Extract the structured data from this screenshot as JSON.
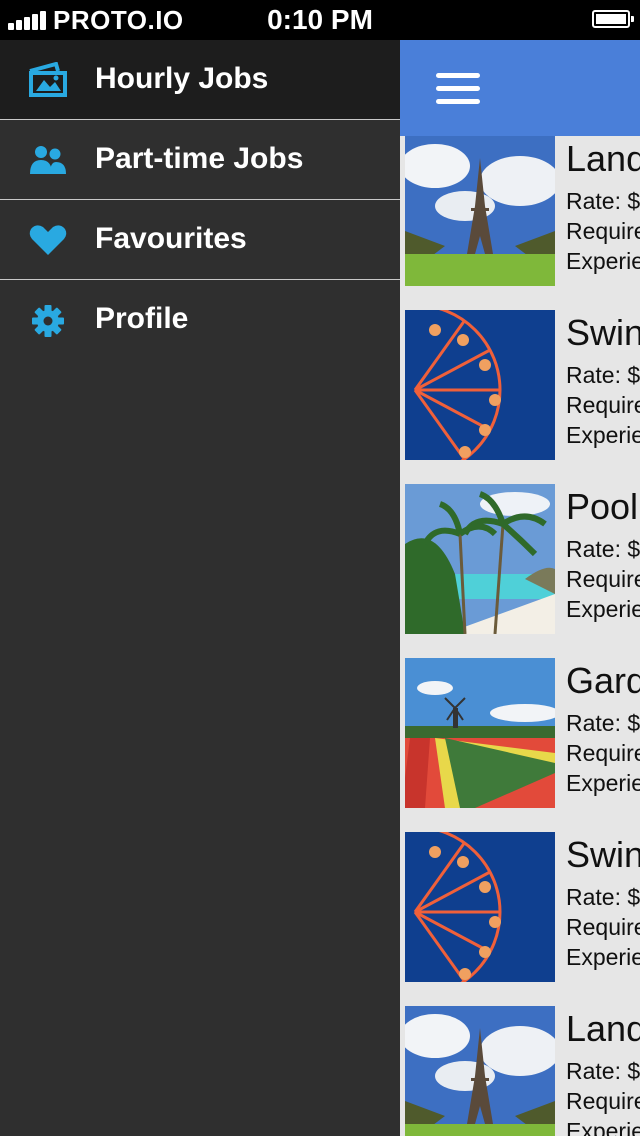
{
  "status": {
    "carrier": "PROTO.IO",
    "time": "0:10 PM"
  },
  "menu": {
    "items": [
      {
        "label": "Hourly Jobs",
        "icon": "photo-icon",
        "active": true
      },
      {
        "label": "Part-time Jobs",
        "icon": "users-icon",
        "active": false
      },
      {
        "label": "Favourites",
        "icon": "heart-icon",
        "active": false
      },
      {
        "label": "Profile",
        "icon": "gear-icon",
        "active": false
      }
    ]
  },
  "colors": {
    "accent": "#4a7fd9",
    "icon": "#29a9e1",
    "menu_bg": "#2f2f2f",
    "menu_active_bg": "#1d1d1d",
    "list_bg": "#e6e6e6"
  },
  "header": {
    "menu_icon": "hamburger-icon"
  },
  "jobs": [
    {
      "title": "Land",
      "rate": "Rate: $",
      "requirements": "Require",
      "experience": "Experie",
      "image": "eiffel-tower"
    },
    {
      "title": "Swin",
      "rate": "Rate: $",
      "requirements": "Require",
      "experience": "Experie",
      "image": "ferris-wheel"
    },
    {
      "title": "Pool",
      "rate": "Rate: $",
      "requirements": "Require",
      "experience": "Experie",
      "image": "palm-beach"
    },
    {
      "title": "Gard",
      "rate": "Rate: $",
      "requirements": "Require",
      "experience": "Experie",
      "image": "tulip-field"
    },
    {
      "title": "Swin",
      "rate": "Rate: $",
      "requirements": "Require",
      "experience": "Experie",
      "image": "ferris-wheel"
    },
    {
      "title": "Land",
      "rate": "Rate: $",
      "requirements": "Require",
      "experience": "Experie",
      "image": "eiffel-tower"
    }
  ]
}
